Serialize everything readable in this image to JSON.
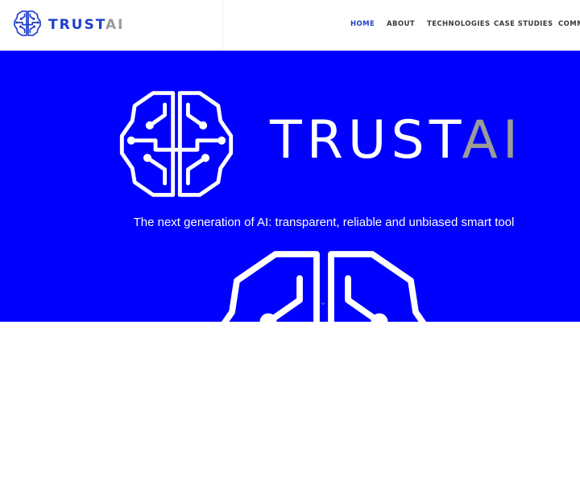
{
  "colors": {
    "hero_bg": "#0000ff",
    "brand_blue": "#1f3fc9",
    "accent_gray": "#9b9b9b",
    "white": "#ffffff",
    "nav_text": "#3b3b3b"
  },
  "header": {
    "logo": {
      "icon": "brain-circuit-icon",
      "primary": "TRUST",
      "secondary": "AI"
    },
    "nav": [
      {
        "label": "HOME",
        "active": true
      },
      {
        "label": "ABOUT"
      },
      {
        "label": "TECHNOLOGIES"
      },
      {
        "label": "CASE STUDIES"
      },
      {
        "label": "COMM"
      }
    ]
  },
  "hero": {
    "logo_icon": "brain-circuit-icon",
    "title_primary": "TRUST",
    "title_secondary": "AI",
    "tagline": "The next generation of AI: transparent, reliable and unbiased smart tool",
    "scroll_icon": "chevron-down-icon"
  }
}
